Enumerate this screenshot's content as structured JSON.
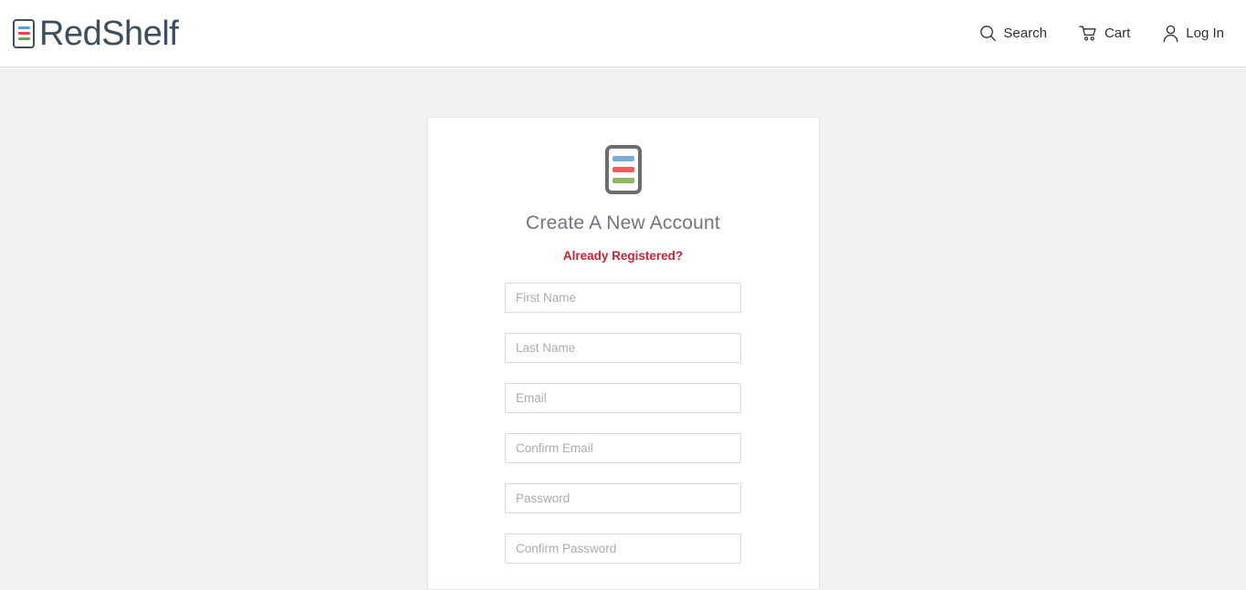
{
  "header": {
    "brand": {
      "name": "RedShelf",
      "icon": "redshelf-book-icon",
      "bar_colors": [
        "#5b9bd5",
        "#e8444f",
        "#6aa84f"
      ]
    },
    "nav": [
      {
        "label": "Search",
        "icon": "search-icon",
        "name": "nav-search"
      },
      {
        "label": "Cart",
        "icon": "cart-icon",
        "name": "nav-cart"
      },
      {
        "label": "Log In",
        "icon": "user-icon",
        "name": "nav-login"
      }
    ]
  },
  "card": {
    "icon": "book-bars-icon",
    "icon_bar_colors": [
      "#7fa9d6",
      "#ef5d5d",
      "#8fb863"
    ],
    "title": "Create A New Account",
    "existing_account_link": "Already Registered?",
    "link_color": "#cc2233",
    "fields": [
      {
        "name": "first-name-input",
        "placeholder": "First Name",
        "value": "",
        "type": "text"
      },
      {
        "name": "last-name-input",
        "placeholder": "Last Name",
        "value": "",
        "type": "text"
      },
      {
        "name": "email-input",
        "placeholder": "Email",
        "value": "",
        "type": "text"
      },
      {
        "name": "confirm-email-input",
        "placeholder": "Confirm Email",
        "value": "",
        "type": "text"
      },
      {
        "name": "password-input",
        "placeholder": "Password",
        "value": "",
        "type": "password"
      },
      {
        "name": "confirm-password-input",
        "placeholder": "Confirm Password",
        "value": "",
        "type": "password"
      }
    ]
  },
  "theme": {
    "page_background": "#f0f1f3",
    "card_background": "#ffffff",
    "brand_text_color": "#3d4f5c",
    "title_color": "#6f7680"
  }
}
